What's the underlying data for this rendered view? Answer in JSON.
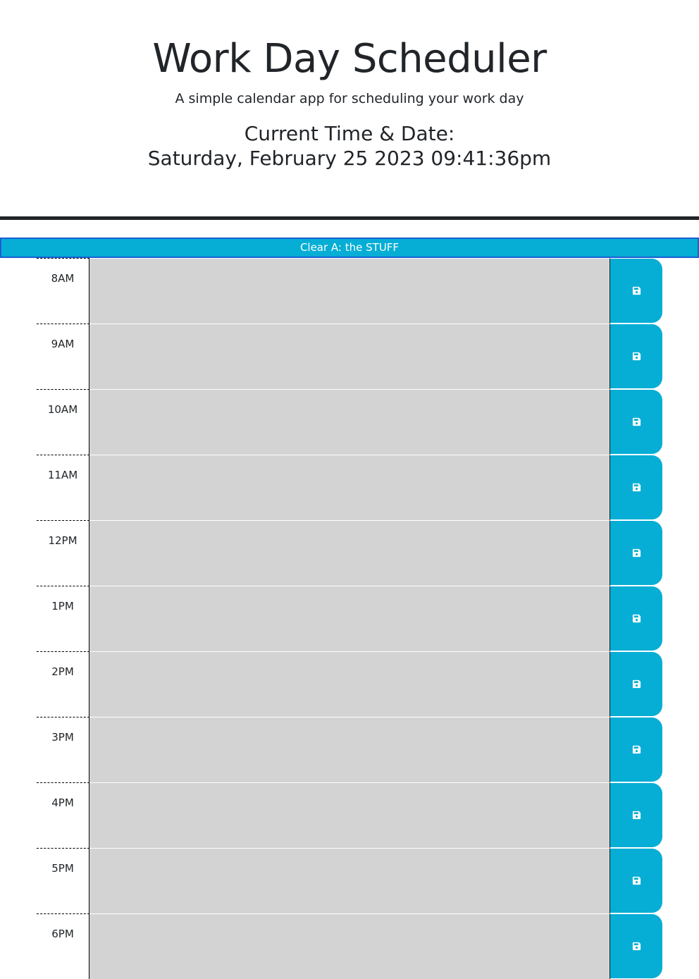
{
  "header": {
    "title": "Work Day Scheduler",
    "lead": "A simple calendar app for scheduling your work day",
    "time_label": "Current Time & Date:",
    "time_value": "Saturday, February 25 2023 09:41:36pm"
  },
  "clear_button": {
    "label": "Clear A: the STUFF"
  },
  "colors": {
    "accent": "#06aed5",
    "past": "#d3d3d3",
    "divider": "#212529"
  },
  "rows": [
    {
      "hour": "8AM",
      "text": "",
      "save_icon": "save-icon"
    },
    {
      "hour": "9AM",
      "text": "",
      "save_icon": "save-icon"
    },
    {
      "hour": "10AM",
      "text": "",
      "save_icon": "save-icon"
    },
    {
      "hour": "11AM",
      "text": "",
      "save_icon": "save-icon"
    },
    {
      "hour": "12PM",
      "text": "",
      "save_icon": "save-icon"
    },
    {
      "hour": "1PM",
      "text": "",
      "save_icon": "save-icon"
    },
    {
      "hour": "2PM",
      "text": "",
      "save_icon": "save-icon"
    },
    {
      "hour": "3PM",
      "text": "",
      "save_icon": "save-icon"
    },
    {
      "hour": "4PM",
      "text": "",
      "save_icon": "save-icon"
    },
    {
      "hour": "5PM",
      "text": "",
      "save_icon": "save-icon"
    },
    {
      "hour": "6PM",
      "text": "",
      "save_icon": "save-icon"
    }
  ]
}
